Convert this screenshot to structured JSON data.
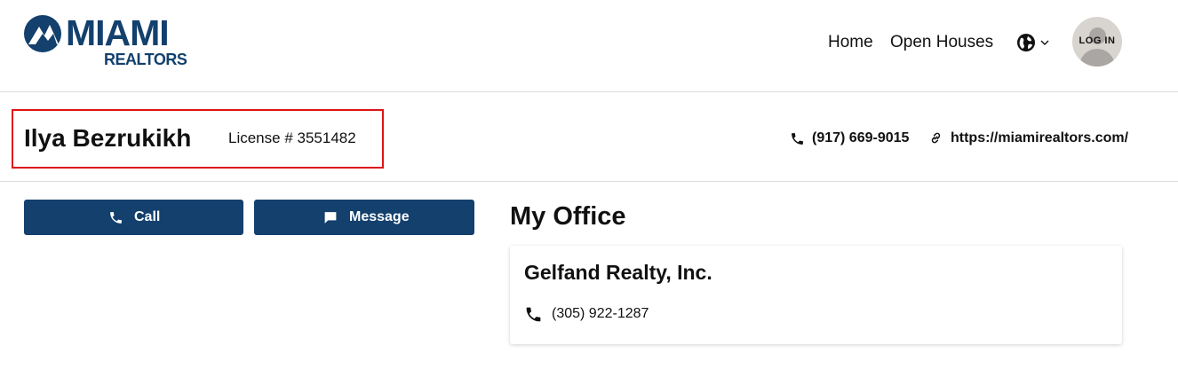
{
  "header": {
    "logo": {
      "brand": "MIAMI",
      "sub": "REALTORS"
    },
    "nav": [
      {
        "label": "Home"
      },
      {
        "label": "Open Houses"
      }
    ],
    "language_icon": "globe-icon",
    "login_label": "LOG IN"
  },
  "agent": {
    "name": "Ilya Bezrukikh",
    "license": "License # 3551482",
    "phone": "(917) 669-9015",
    "website": "https://miamirealtors.com/"
  },
  "actions": {
    "call_label": "Call",
    "message_label": "Message"
  },
  "office": {
    "section_title": "My Office",
    "name": "Gelfand Realty, Inc.",
    "phone": "(305) 922-1287"
  },
  "colors": {
    "brand": "#13406d",
    "highlight": "#e01414"
  }
}
